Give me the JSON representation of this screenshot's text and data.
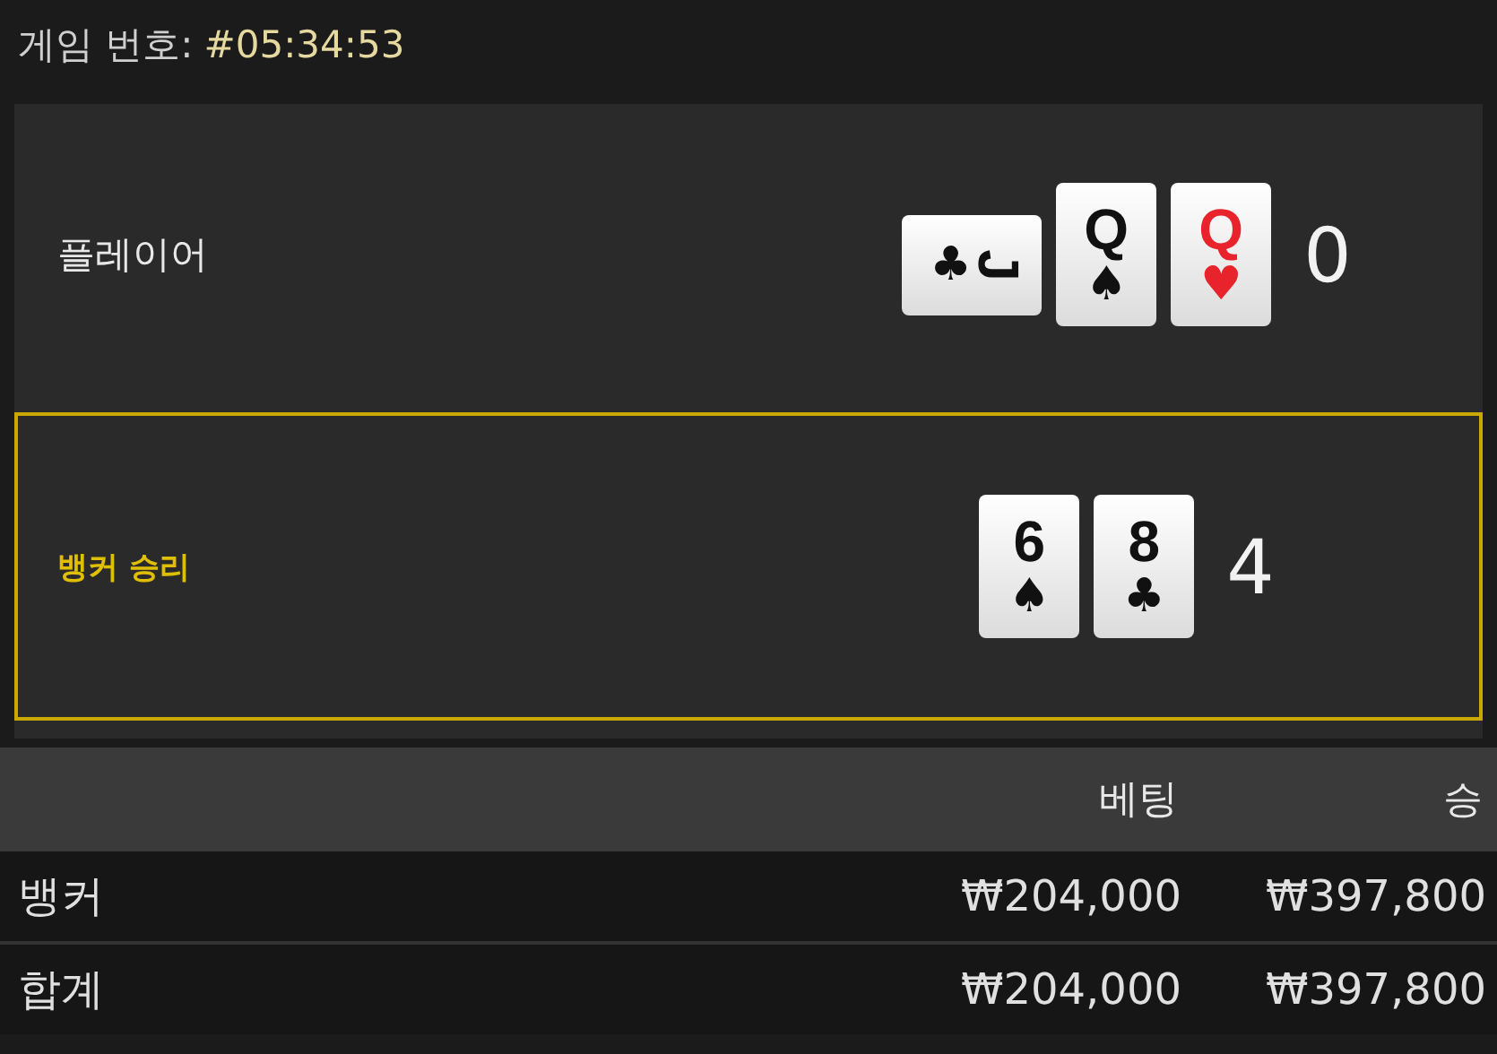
{
  "header": {
    "label": "게임 번호:",
    "game_number": "#05:34:53"
  },
  "hands": [
    {
      "name": "플레이어",
      "winner": false,
      "score": "0",
      "cards": [
        {
          "rank": "J",
          "suit": "♣",
          "red": false,
          "sideways": true
        },
        {
          "rank": "Q",
          "suit": "♠",
          "red": false,
          "sideways": false
        },
        {
          "rank": "Q",
          "suit": "♥",
          "red": true,
          "sideways": false
        }
      ]
    },
    {
      "name": "뱅커 승리",
      "winner": true,
      "score": "4",
      "cards": [
        {
          "rank": "6",
          "suit": "♠",
          "red": false,
          "sideways": false
        },
        {
          "rank": "8",
          "suit": "♣",
          "red": false,
          "sideways": false
        }
      ]
    }
  ],
  "table": {
    "columns": [
      "베팅",
      "승"
    ],
    "rows": [
      {
        "label": "뱅커",
        "bet": "₩204,000",
        "win": "₩397,800"
      },
      {
        "label": "합계",
        "bet": "₩204,000",
        "win": "₩397,800"
      }
    ]
  }
}
